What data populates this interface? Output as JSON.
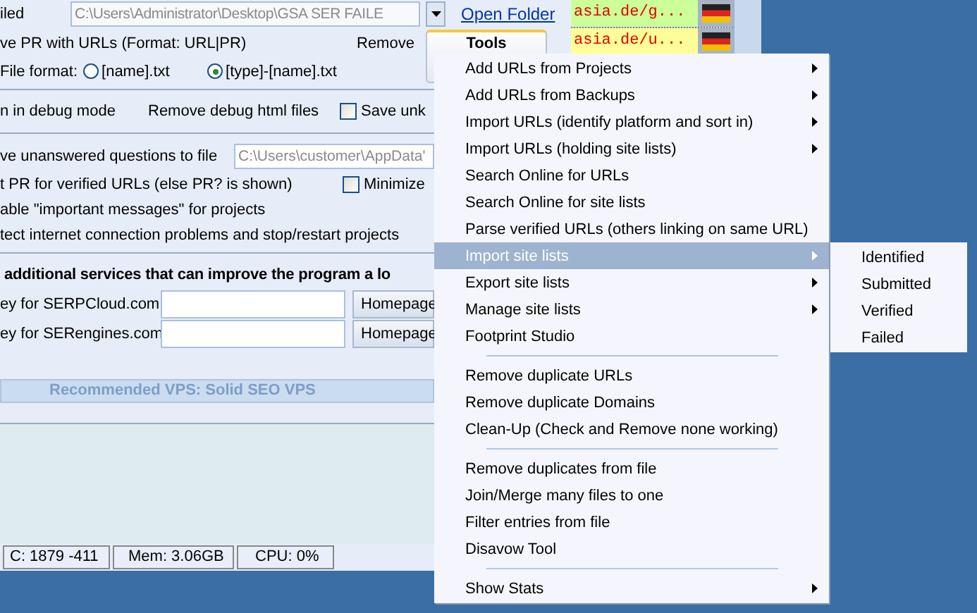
{
  "output_folder": {
    "label": "iled",
    "path": "C:\\Users\\Administrator\\Desktop\\GSA SER FAILE",
    "link": "Open Folder"
  },
  "save_pr": {
    "label": "ve PR with URLs (Format: URL|PR)",
    "remove_label": "Remove"
  },
  "file_format": {
    "label": "File format:",
    "options": [
      {
        "label": "[name].txt",
        "selected": false
      },
      {
        "label": "[type]-[name].txt",
        "selected": true
      }
    ]
  },
  "tools_button": "Tools",
  "debug": {
    "label": "n in debug mode",
    "remove_label": "Remove debug html files",
    "save_checkbox": {
      "label": "Save unk",
      "checked": false
    }
  },
  "unanswered": {
    "label": "ve unanswered questions to file",
    "path": "C:\\Users\\customer\\AppData'"
  },
  "pr_option": {
    "label": "t PR for verified URLs (else PR? is shown)",
    "minimize_checkbox": {
      "label": "Minimize",
      "checked": false
    }
  },
  "messages_option": "able \"important messages\" for projects",
  "connection_option": "tect internet connection problems and stop/restart projects",
  "services": {
    "title": "additional services that can improve the program a lo",
    "keys": [
      {
        "label": "ey for SERPCloud.com",
        "button": "Homepage"
      },
      {
        "label": "ey for SERengines.com",
        "button": "Homepage"
      }
    ]
  },
  "vps_banner": "Recommended VPS: Solid SEO VPS",
  "status_bar": [
    "C: 1879 -411",
    "Mem: 3.06GB",
    "CPU: 0%"
  ],
  "url_list": [
    {
      "url": "asia.de/g...",
      "color": "#ccff99",
      "kind": "de"
    },
    {
      "url": "asia.de/u...",
      "color": "#ffff99",
      "kind": "de"
    }
  ],
  "menu": {
    "items": [
      {
        "kind": "item",
        "label": "Add URLs from Projects",
        "submenu": true,
        "selected": false
      },
      {
        "kind": "item",
        "label": "Add URLs from Backups",
        "submenu": true,
        "selected": false
      },
      {
        "kind": "item",
        "label": "Import URLs (identify platform and sort in)",
        "submenu": true,
        "selected": false
      },
      {
        "kind": "item",
        "label": "Import URLs (holding site lists)",
        "submenu": true,
        "selected": false
      },
      {
        "kind": "item",
        "label": "Search Online for URLs",
        "submenu": false,
        "selected": false
      },
      {
        "kind": "item",
        "label": "Search Online for site lists",
        "submenu": false,
        "selected": false
      },
      {
        "kind": "item",
        "label": "Parse verified URLs (others linking on same URL)",
        "submenu": false,
        "selected": false
      },
      {
        "kind": "item",
        "label": "Import site lists",
        "submenu": true,
        "selected": true
      },
      {
        "kind": "item",
        "label": "Export site lists",
        "submenu": true,
        "selected": false
      },
      {
        "kind": "item",
        "label": "Manage site lists",
        "submenu": true,
        "selected": false
      },
      {
        "kind": "item",
        "label": "Footprint Studio",
        "submenu": false,
        "selected": false
      },
      {
        "kind": "separator"
      },
      {
        "kind": "item",
        "label": "Remove duplicate URLs",
        "submenu": false,
        "selected": false
      },
      {
        "kind": "item",
        "label": "Remove duplicate Domains",
        "submenu": false,
        "selected": false
      },
      {
        "kind": "item",
        "label": "Clean-Up (Check and Remove none working)",
        "submenu": false,
        "selected": false
      },
      {
        "kind": "separator"
      },
      {
        "kind": "item",
        "label": "Remove duplicates from file",
        "submenu": false,
        "selected": false
      },
      {
        "kind": "item",
        "label": "Join/Merge many files to one",
        "submenu": false,
        "selected": false
      },
      {
        "kind": "item",
        "label": "Filter entries from file",
        "submenu": false,
        "selected": false
      },
      {
        "kind": "item",
        "label": "Disavow Tool",
        "submenu": false,
        "selected": false
      },
      {
        "kind": "separator"
      },
      {
        "kind": "item",
        "label": "Show Stats",
        "submenu": true,
        "selected": false
      }
    ]
  },
  "submenu": {
    "items": [
      "Identified",
      "Submitted",
      "Verified",
      "Failed"
    ]
  }
}
